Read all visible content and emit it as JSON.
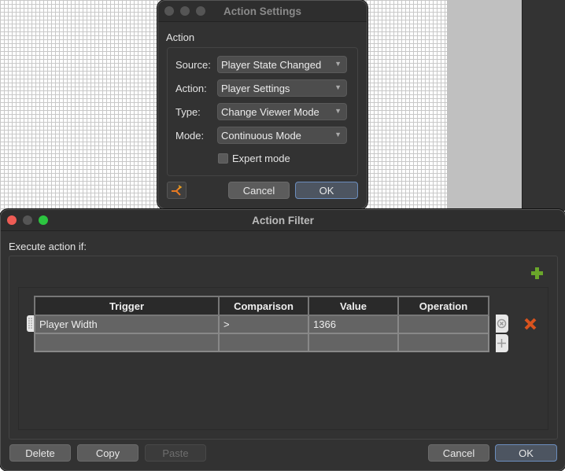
{
  "action_settings": {
    "title": "Action Settings",
    "group_label": "Action",
    "fields": [
      {
        "label": "Source:",
        "value": "Player State Changed"
      },
      {
        "label": "Action:",
        "value": "Player Settings"
      },
      {
        "label": "Type:",
        "value": "Change Viewer Mode"
      },
      {
        "label": "Mode:",
        "value": "Continuous Mode"
      }
    ],
    "expert_mode_label": "Expert mode",
    "expert_mode_checked": false,
    "cancel_label": "Cancel",
    "ok_label": "OK"
  },
  "action_filter": {
    "title": "Action Filter",
    "section_label": "Execute action if:",
    "table": {
      "columns": [
        "Trigger",
        "Comparison",
        "Value",
        "Operation"
      ],
      "rows": [
        [
          "Player Width",
          ">",
          "1366",
          ""
        ],
        [
          "",
          "",
          "",
          ""
        ]
      ]
    },
    "buttons": {
      "delete": "Delete",
      "copy": "Copy",
      "paste": "Paste",
      "cancel": "Cancel",
      "ok": "OK"
    },
    "colors": {
      "add": "#6aa62a",
      "remove": "#d9531e"
    }
  }
}
